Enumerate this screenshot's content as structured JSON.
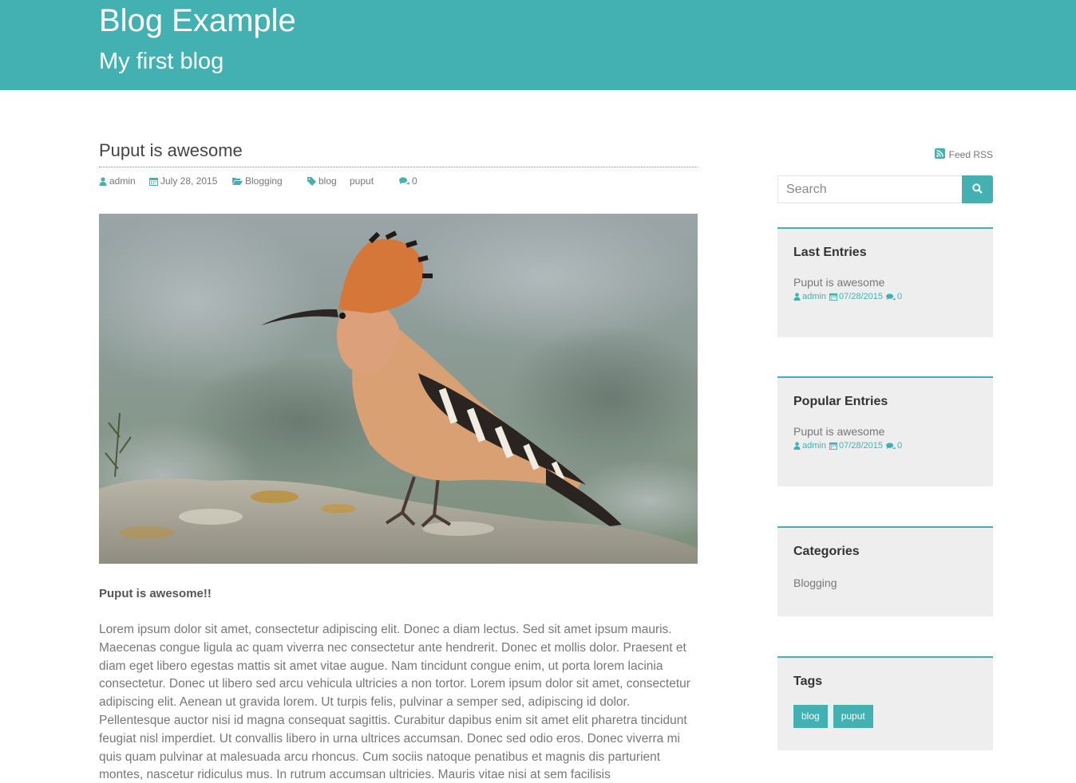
{
  "header": {
    "title": "Blog Example",
    "subtitle": "My first blog"
  },
  "post": {
    "title": "Puput is awesome",
    "meta": {
      "author": "admin",
      "date": "July 28, 2015",
      "category": "Blogging",
      "tags": [
        "blog",
        "puput"
      ],
      "comments": "0"
    },
    "lead": "Puput is awesome!!",
    "body": "Lorem ipsum dolor sit amet, consectetur adipiscing elit. Donec a diam lectus. Sed sit amet ipsum mauris. Maecenas congue ligula ac quam viverra nec consectetur ante hendrerit. Donec et mollis dolor. Praesent et diam eget libero egestas mattis sit amet vitae augue. Nam tincidunt congue enim, ut porta lorem lacinia consectetur. Donec ut libero sed arcu vehicula ultricies a non tortor. Lorem ipsum dolor sit amet, consectetur adipiscing elit. Aenean ut gravida lorem. Ut turpis felis, pulvinar a semper sed, adipiscing id dolor. Pellentesque auctor nisi id magna consequat sagittis. Curabitur dapibus enim sit amet elit pharetra tincidunt feugiat nisl imperdiet. Ut convallis libero in urna ultrices accumsan. Donec sed odio eros. Donec viverra mi quis quam pulvinar at malesuada arcu rhoncus. Cum sociis natoque penatibus et magnis dis parturient montes, nascetur ridiculus mus. In rutrum accumsan ultricies. Mauris vitae nisi at sem facilisis"
  },
  "sidebar": {
    "feed_label": "Feed RSS",
    "search": {
      "placeholder": "Search",
      "value": ""
    },
    "last_entries": {
      "title": "Last Entries",
      "items": [
        {
          "title": "Puput is awesome",
          "author": "admin",
          "date": "07/28/2015",
          "comments": "0"
        }
      ]
    },
    "popular_entries": {
      "title": "Popular Entries",
      "items": [
        {
          "title": "Puput is awesome",
          "author": "admin",
          "date": "07/28/2015",
          "comments": "0"
        }
      ]
    },
    "categories": {
      "title": "Categories",
      "items": [
        "Blogging"
      ]
    },
    "tags": {
      "title": "Tags",
      "items": [
        "blog",
        "puput"
      ]
    }
  },
  "colors": {
    "accent": "#43b1b1",
    "widget_bg": "#eeeeee"
  },
  "icons": [
    "user-icon",
    "calendar-icon",
    "folder-open-icon",
    "tag-icon",
    "comments-icon",
    "rss-icon",
    "search-icon"
  ]
}
